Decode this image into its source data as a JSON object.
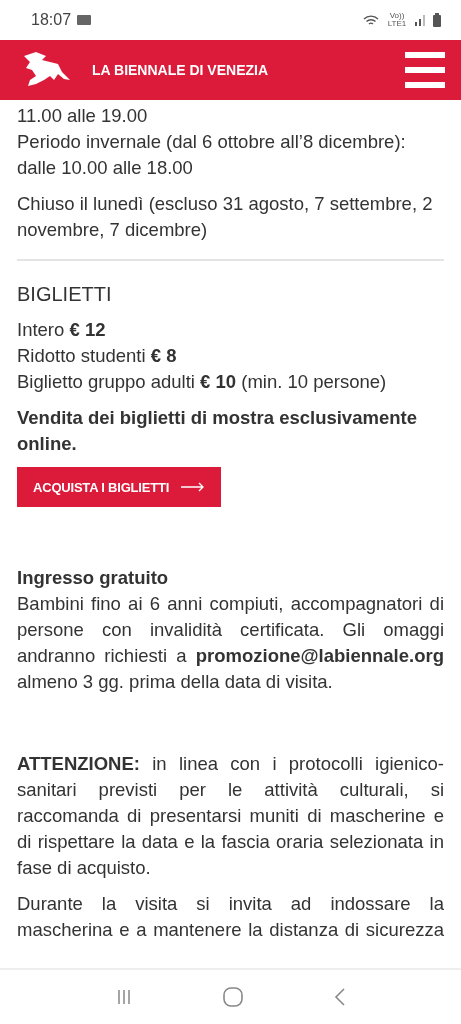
{
  "status_bar": {
    "time": "18:07",
    "network_label": "Vo)) LTE1"
  },
  "header": {
    "title": "LA BIENNALE DI VENEZIA"
  },
  "hours": {
    "paragraphs": [
      {
        "text": "11.00 alle 19.00\nPeriodo invernale (dal 6 ottobre all’8 dicembre): dalle 10.00 alle 18.00",
        "kind": "left"
      },
      {
        "text": "Chiuso il lunedì (escluso 31 agosto, 7 settembre, 2 novembre, 7 dicembre)",
        "kind": "left"
      }
    ]
  },
  "tickets": {
    "title": "BIGLIETTI",
    "prices": [
      "Intero **€ 12**",
      "Ridotto studenti **€ 8**",
      "Biglietto gruppo adulti **€ 10** (min. 10 persone)"
    ],
    "notice": "Vendita dei biglietti di mostra esclusivamente online.",
    "button": "ACQUISTA I BIGLIETTI"
  },
  "free_entry": {
    "title": "Ingresso gratuito",
    "text": "Bambini fino ai 6 anni compiuti, accompagnatori di persone con invalidità certificata. Gli omaggi andranno richiesti a **promozione@labiennale.org** almeno 3 gg. prima della data di visita."
  },
  "notes": [
    {
      "text": "**ATTENZIONE:** in linea con i protocolli igienico-sanitari previsti per le attività culturali, si raccomanda di presentarsi muniti di mascherine e di rispettare la data e la fascia oraria selezionata in fase di acquisto.",
      "kind": "justify"
    },
    {
      "text": "Durante la visita si invita ad indossare la mascherina e a mantenere la distanza di sicurezza",
      "kind": "justify-cut"
    }
  ]
}
